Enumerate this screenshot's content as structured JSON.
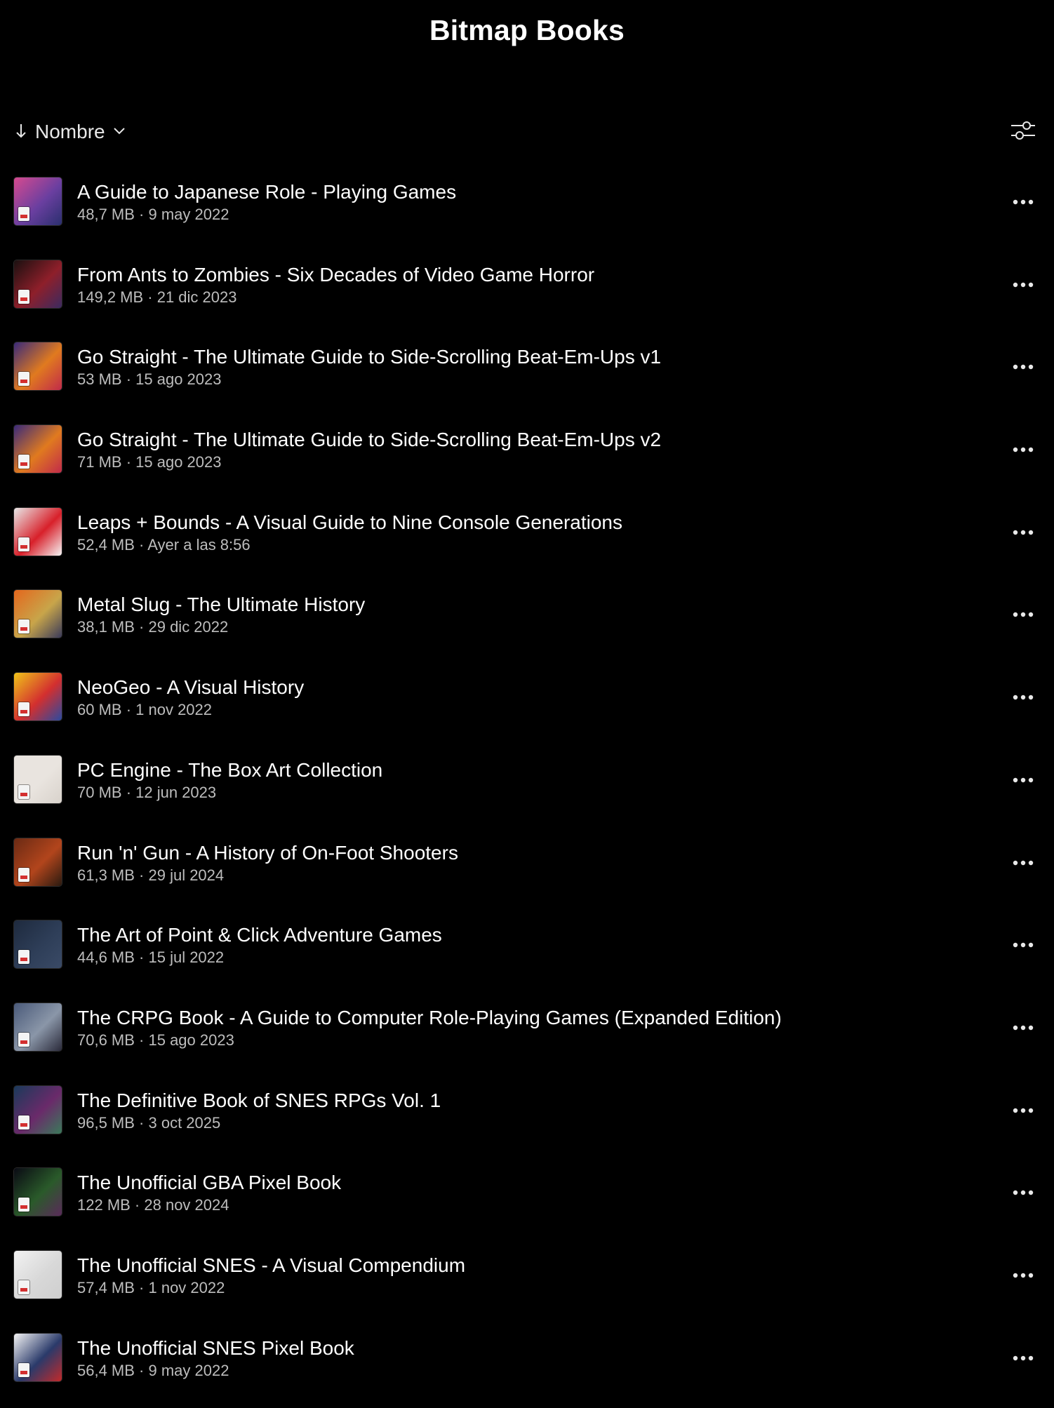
{
  "header": {
    "title": "Bitmap Books"
  },
  "sort": {
    "label": "Nombre",
    "direction_icon": "arrow-down-icon",
    "dropdown_icon": "chevron-down-icon"
  },
  "toolbar": {
    "filter_icon": "sliders-icon"
  },
  "items": [
    {
      "title": "A Guide to Japanese Role - Playing Games",
      "meta": "48,7 MB · 9 may 2022",
      "cover_colors": [
        "#d64a8f",
        "#6a3fa0",
        "#2a2f6e"
      ]
    },
    {
      "title": "From Ants to Zombies - Six Decades of Video Game Horror",
      "meta": "149,2 MB · 21 dic 2023",
      "cover_colors": [
        "#1a1010",
        "#8e1f2a",
        "#3b2a60"
      ]
    },
    {
      "title": "Go Straight - The Ultimate Guide to Side-Scrolling Beat-Em-Ups v1",
      "meta": "53 MB · 15 ago 2023",
      "cover_colors": [
        "#3a2a7a",
        "#e07a1f",
        "#c12a4a"
      ]
    },
    {
      "title": "Go Straight - The Ultimate Guide to Side-Scrolling Beat-Em-Ups v2",
      "meta": "71 MB · 15 ago 2023",
      "cover_colors": [
        "#3a2a7a",
        "#e07a1f",
        "#c12a4a"
      ]
    },
    {
      "title": "Leaps + Bounds - A Visual Guide to Nine Console Generations",
      "meta": "52,4 MB · Ayer a las 8:56",
      "cover_colors": [
        "#e8e8e8",
        "#d8202a",
        "#f5f5f5"
      ]
    },
    {
      "title": "Metal Slug - The Ultimate History",
      "meta": "38,1 MB · 29 dic 2022",
      "cover_colors": [
        "#e4671d",
        "#c8a54a",
        "#3a3a5a"
      ]
    },
    {
      "title": "NeoGeo - A Visual History",
      "meta": "60 MB · 1 nov 2022",
      "cover_colors": [
        "#f0c419",
        "#d32f2f",
        "#2a4aa0"
      ]
    },
    {
      "title": "PC Engine - The Box Art Collection",
      "meta": "70 MB · 12 jun 2023",
      "cover_colors": [
        "#e9e4df",
        "#e9e4df",
        "#d8d2cb"
      ]
    },
    {
      "title": "Run 'n' Gun - A History of On-Foot Shooters",
      "meta": "61,3 MB · 29 jul 2024",
      "cover_colors": [
        "#6a2a14",
        "#b2451c",
        "#2a1a10"
      ]
    },
    {
      "title": "The Art of Point & Click Adventure Games",
      "meta": "44,6 MB · 15 jul 2022",
      "cover_colors": [
        "#1e2a3e",
        "#2e3e58",
        "#3a4a66"
      ]
    },
    {
      "title": "The CRPG Book - A Guide to Computer Role-Playing Games (Expanded Edition)",
      "meta": "70,6 MB · 15 ago 2023",
      "cover_colors": [
        "#4a5a7a",
        "#8a96a8",
        "#2a2a3a"
      ]
    },
    {
      "title": "The Definitive Book of SNES RPGs Vol. 1",
      "meta": "96,5 MB · 3 oct 2025",
      "cover_colors": [
        "#1a3a5a",
        "#6a2a6a",
        "#3a7a5a"
      ]
    },
    {
      "title": "The Unofficial GBA Pixel Book",
      "meta": "122 MB · 28 nov 2024",
      "cover_colors": [
        "#0a0a14",
        "#2a5a2a",
        "#5a2a5a"
      ]
    },
    {
      "title": "The Unofficial SNES - A Visual Compendium",
      "meta": "57,4 MB · 1 nov 2022",
      "cover_colors": [
        "#f2f2f2",
        "#d8d8d8",
        "#cfcfcf"
      ]
    },
    {
      "title": "The Unofficial SNES Pixel Book",
      "meta": "56,4 MB · 9 may 2022",
      "cover_colors": [
        "#f5f5f5",
        "#2a3a6a",
        "#c22a2a"
      ]
    }
  ],
  "item_menu_icon": "more-horizontal-icon"
}
